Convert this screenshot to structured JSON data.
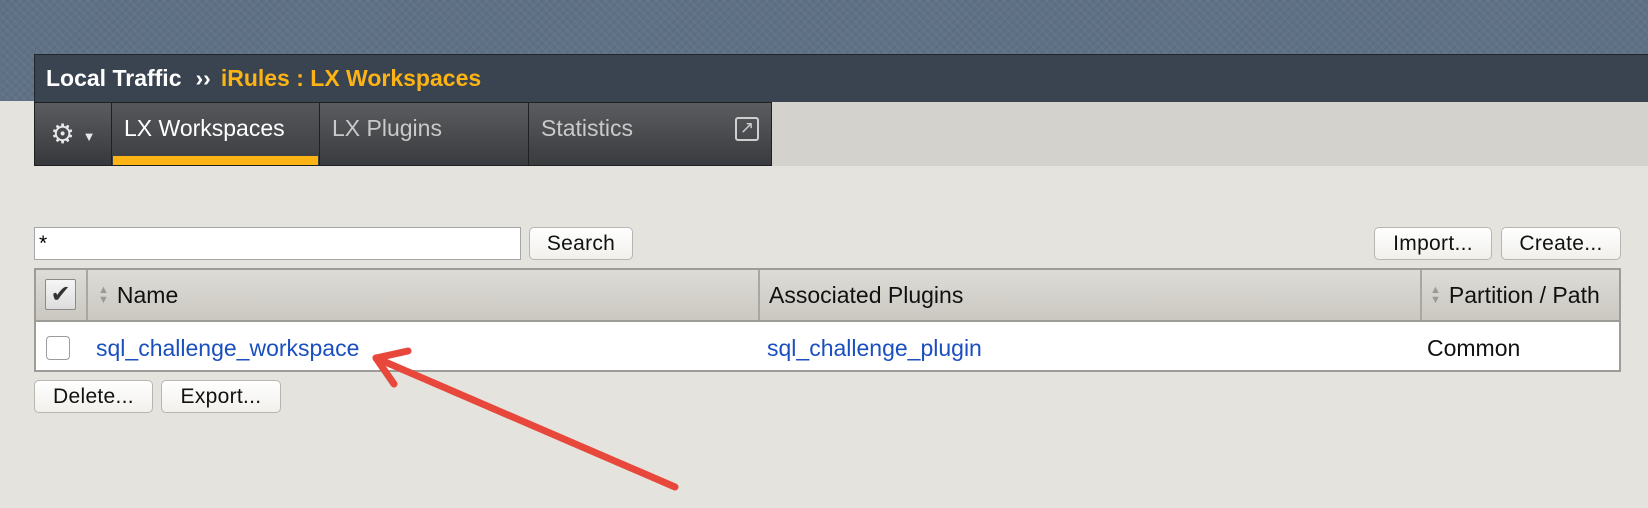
{
  "breadcrumb": {
    "root": "Local Traffic",
    "separator": "››",
    "current": "iRules : LX Workspaces"
  },
  "tabs": [
    {
      "label": "LX Workspaces",
      "active": true
    },
    {
      "label": "LX Plugins",
      "active": false
    },
    {
      "label": "Statistics",
      "active": false
    }
  ],
  "icons": {
    "gear": "gear-icon",
    "caret": "caret-down-icon",
    "external": "external-link-icon",
    "checkmark": "checkmark-icon"
  },
  "search": {
    "value": "*",
    "button_label": "Search"
  },
  "actions": {
    "import_label": "Import...",
    "create_label": "Create...",
    "delete_label": "Delete...",
    "export_label": "Export..."
  },
  "table": {
    "columns": [
      "Name",
      "Associated Plugins",
      "Partition / Path"
    ],
    "rows": [
      {
        "name": "sql_challenge_workspace",
        "plugins": "sql_challenge_plugin",
        "partition": "Common"
      }
    ]
  },
  "colors": {
    "accent": "#fcb415",
    "link": "#1a4fbf",
    "annotation_arrow": "#e8483b"
  }
}
